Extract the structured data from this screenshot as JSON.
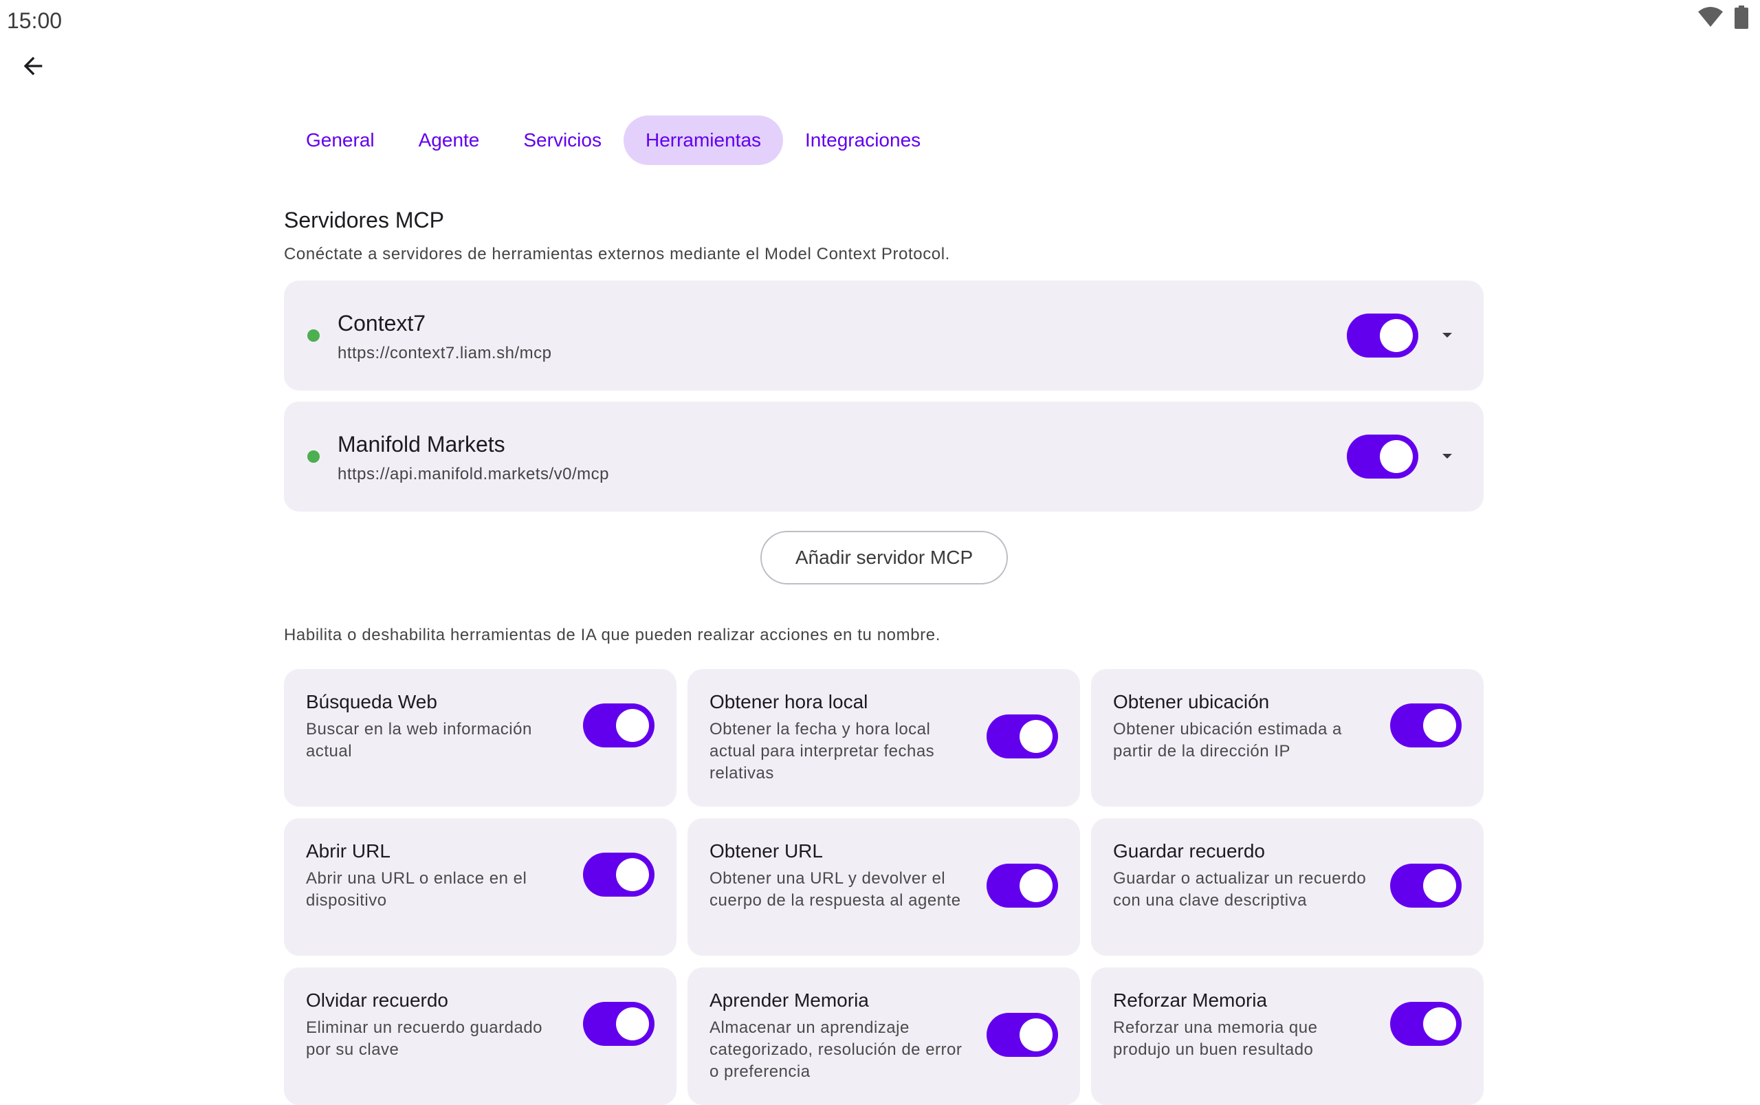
{
  "status_bar": {
    "time": "15:00",
    "icons": [
      "wifi-icon",
      "battery-icon"
    ]
  },
  "colors": {
    "accent": "#6200ee",
    "tab_active_bg": "#e3d1fb",
    "card_bg": "#f2eef6",
    "status_ok": "#4caf50"
  },
  "tabs": [
    {
      "label": "General",
      "active": false
    },
    {
      "label": "Agente",
      "active": false
    },
    {
      "label": "Servicios",
      "active": false
    },
    {
      "label": "Herramientas",
      "active": true
    },
    {
      "label": "Integraciones",
      "active": false
    }
  ],
  "mcp": {
    "title": "Servidores MCP",
    "description": "Conéctate a servidores de herramientas externos mediante el Model Context Protocol.",
    "servers": [
      {
        "name": "Context7",
        "url": "https://context7.liam.sh/mcp",
        "enabled": true,
        "status": "connected"
      },
      {
        "name": "Manifold Markets",
        "url": "https://api.manifold.markets/v0/mcp",
        "enabled": true,
        "status": "connected"
      }
    ],
    "add_button": "Añadir servidor MCP"
  },
  "tools": {
    "description": "Habilita o deshabilita herramientas de IA que pueden realizar acciones en tu nombre.",
    "items": [
      {
        "name": "Búsqueda Web",
        "desc": "Buscar en la web información actual",
        "enabled": true
      },
      {
        "name": "Obtener hora local",
        "desc": "Obtener la fecha y hora local actual para interpretar fechas relativas",
        "enabled": true
      },
      {
        "name": "Obtener ubicación",
        "desc": "Obtener ubicación estimada a partir de la dirección IP",
        "enabled": true
      },
      {
        "name": "Abrir URL",
        "desc": "Abrir una URL o enlace en el dispositivo",
        "enabled": true
      },
      {
        "name": "Obtener URL",
        "desc": "Obtener una URL y devolver el cuerpo de la respuesta al agente",
        "enabled": true
      },
      {
        "name": "Guardar recuerdo",
        "desc": "Guardar o actualizar un recuerdo con una clave descriptiva",
        "enabled": true
      },
      {
        "name": "Olvidar recuerdo",
        "desc": "Eliminar un recuerdo guardado por su clave",
        "enabled": true
      },
      {
        "name": "Aprender Memoria",
        "desc": "Almacenar un aprendizaje categorizado, resolución de error o preferencia",
        "enabled": true
      },
      {
        "name": "Reforzar Memoria",
        "desc": "Reforzar una memoria que produjo un buen resultado",
        "enabled": true
      }
    ]
  }
}
